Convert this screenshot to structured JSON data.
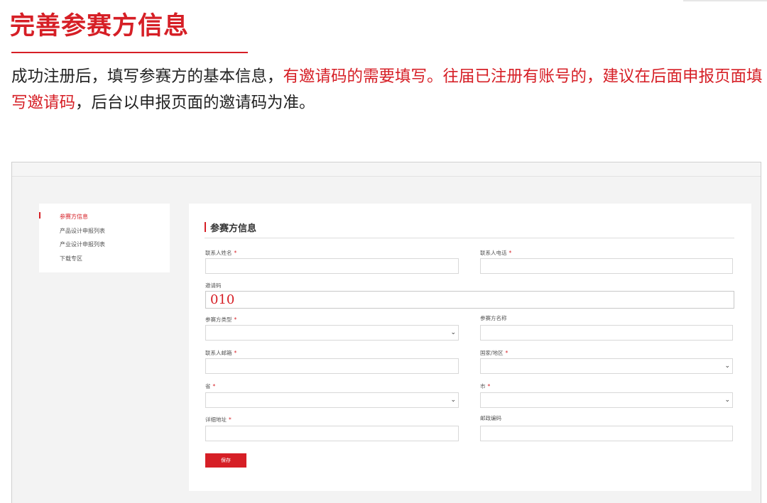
{
  "heading": "完善参赛方信息",
  "intro": {
    "part1": "成功注册后，填写参赛方的基本信息，",
    "part2_red": "有邀请码的需要填写。往届已注册有账号的，建议在后面申报页面填写邀请码",
    "part3": "，后台以申报页面的邀请码为准。"
  },
  "sidebar": {
    "items": [
      {
        "label": "参赛方信息",
        "active": true
      },
      {
        "label": "产品设计申报列表",
        "active": false
      },
      {
        "label": "产业设计申报列表",
        "active": false
      },
      {
        "label": "下载专区",
        "active": false
      }
    ]
  },
  "form": {
    "title": "参赛方信息",
    "required_mark": "*",
    "contact_name_label": "联系人姓名",
    "contact_phone_label": "联系人电话",
    "invite_code_label": "邀请码",
    "invite_code_value": "010",
    "participant_type_label": "参赛方类型",
    "participant_name_label": "参赛方名称",
    "contact_email_label": "联系人邮箱",
    "country_label": "国家/地区",
    "province_label": "省",
    "city_label": "市",
    "address_label": "详细地址",
    "postcode_label": "邮政编码",
    "save_label": "保存"
  },
  "colors": {
    "accent": "#d61f26",
    "frame_bg": "#f3f3f3",
    "text": "#222222"
  },
  "icons": {
    "select_arrow": "chevron-down-icon"
  }
}
